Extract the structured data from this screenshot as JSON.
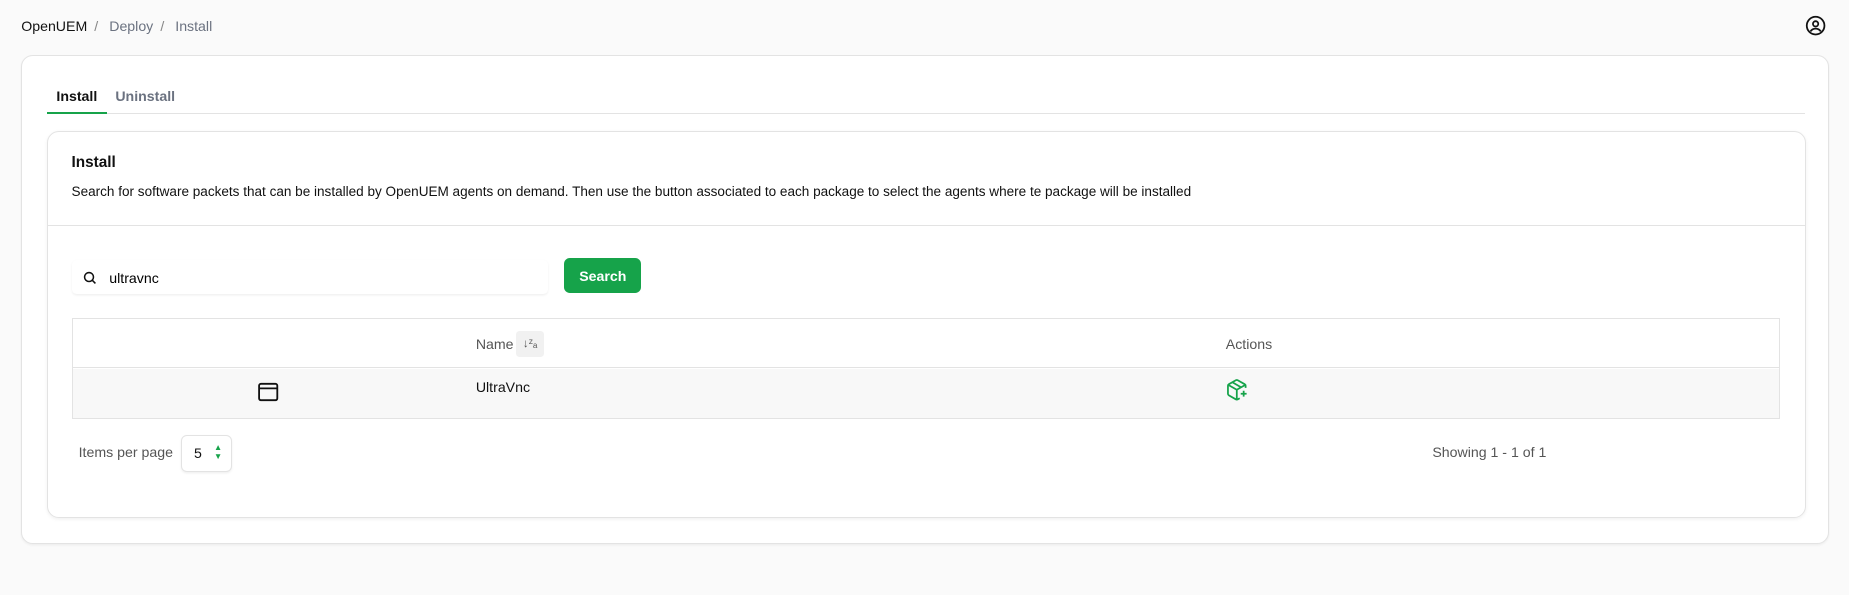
{
  "breadcrumb": [
    "OpenUEM",
    "Deploy",
    "Install"
  ],
  "tabs": [
    {
      "label": "Install",
      "active": true
    },
    {
      "label": "Uninstall",
      "active": false
    }
  ],
  "card": {
    "title": "Install",
    "description": "Search for software packets that can be installed by OpenUEM agents on demand. Then use the button associated to each package to select the agents where te package will be installed"
  },
  "search": {
    "value": "ultravnc",
    "button": "Search"
  },
  "table": {
    "columns": [
      "",
      "Name",
      "Actions"
    ],
    "rows": [
      {
        "icon": "app-window-icon",
        "name": "UltraVnc",
        "action_icon": "package-plus-icon"
      }
    ]
  },
  "pagination": {
    "items_per_page_label": "Items per page",
    "items_per_page": "5",
    "showing": "Showing 1 - 1 of 1"
  },
  "colors": {
    "accent": "#16a34a"
  }
}
